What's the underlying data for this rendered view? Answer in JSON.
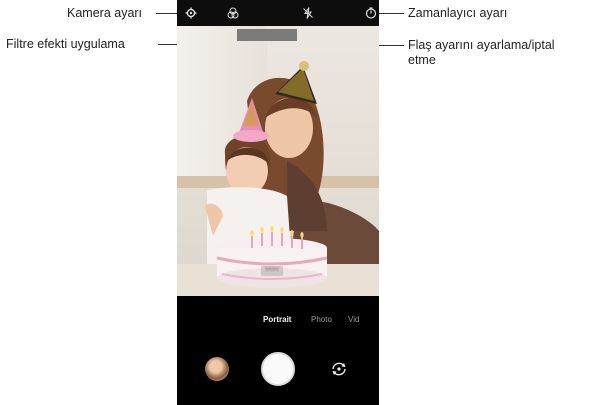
{
  "callouts": {
    "camera_settings": "Kamera ayarı",
    "filter_effect": "Filtre efekti uygulama",
    "flash": "Flaş ayarını ayarlama/iptal etme",
    "timer": "Zamanlayıcı ayarı"
  },
  "modes": {
    "portrait": "Portrait",
    "photo": "Photo",
    "video": "Vid"
  },
  "cake_label": "Mom",
  "icons": {
    "settings": "gear-icon",
    "filter": "filter-icon",
    "flash": "flash-off-icon",
    "timer": "timer-icon",
    "gallery": "gallery-thumbnail",
    "shutter": "shutter-button",
    "switch_camera": "switch-camera-icon"
  },
  "colors": {
    "hat_gold": "#c9a227",
    "hat_pink": "#e58fb6",
    "background_ui": "#000000"
  }
}
